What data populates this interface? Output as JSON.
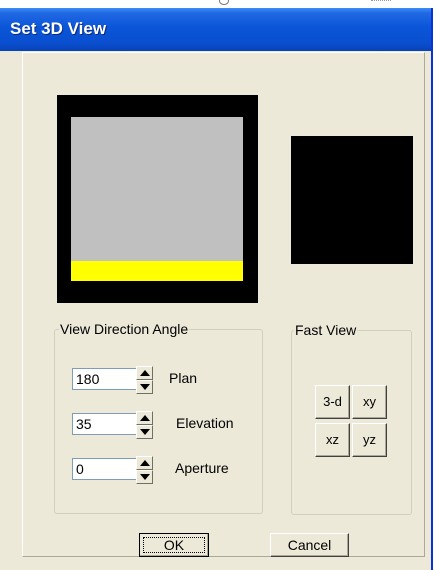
{
  "window": {
    "title": "Set 3D View"
  },
  "view_direction": {
    "group_label": "View Direction Angle",
    "plan": {
      "label": "Plan",
      "value": "180"
    },
    "elevation": {
      "label": "Elevation",
      "value": "35"
    },
    "aperture": {
      "label": "Aperture",
      "value": "0"
    }
  },
  "fast_view": {
    "group_label": "Fast View",
    "buttons": [
      "3-d",
      "xy",
      "xz",
      "yz"
    ]
  },
  "actions": {
    "ok_label": "OK",
    "cancel_label": "Cancel"
  },
  "colors": {
    "titlebar": "#0a55d8",
    "dialog_face": "#ece9d8",
    "preview_background": "#000000",
    "preview_plane": "#c0c0c0",
    "preview_base": "#ffff00"
  },
  "icons": {
    "spin_up": "up-arrow-icon",
    "spin_down": "down-arrow-icon"
  }
}
